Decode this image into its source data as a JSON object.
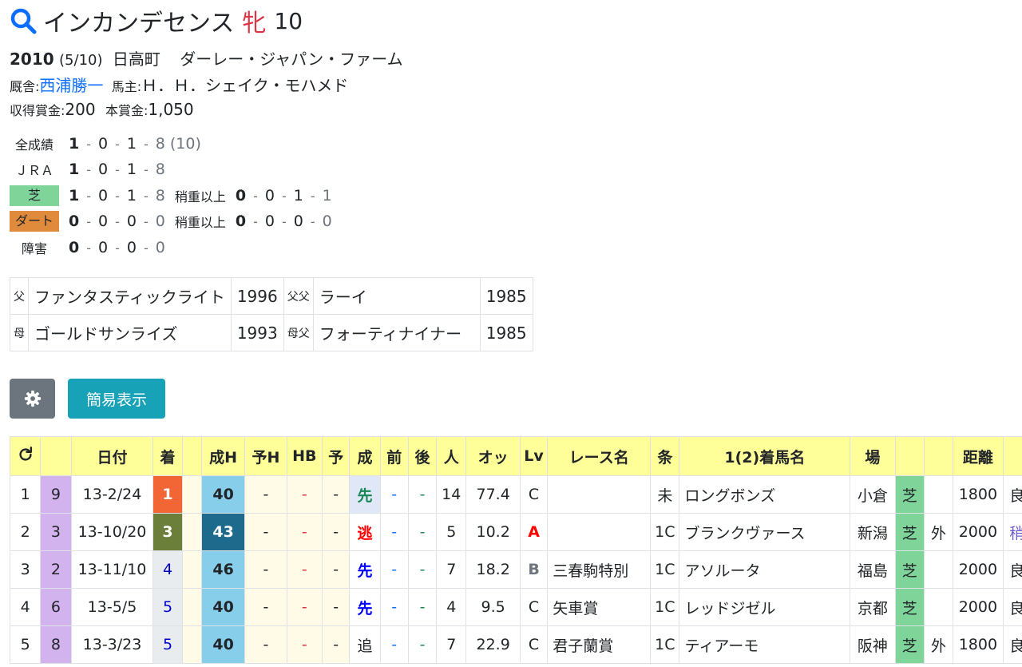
{
  "horse": {
    "name": "インカンデセンス",
    "sex": "牝",
    "age": "10"
  },
  "birth": {
    "year": "2010",
    "date": "(5/10)",
    "place": "日高町",
    "breeder": "ダーレー・ジャパン・ファーム"
  },
  "stable": {
    "label": "厩舎:",
    "trainer": "西浦勝一",
    "owner_label": "馬主:",
    "owner": "Ｈ．Ｈ．シェイク・モハメド"
  },
  "prize": {
    "earned_label": "収得賞金:",
    "earned": "200",
    "main_label": "本賞金:",
    "main": "1,050"
  },
  "records": {
    "all": {
      "label": "全成績",
      "v": [
        "1",
        "0",
        "1",
        "8"
      ],
      "extra": "(10)"
    },
    "jra": {
      "label": "ＪＲＡ",
      "v": [
        "1",
        "0",
        "1",
        "8"
      ]
    },
    "turf": {
      "label": "芝",
      "v": [
        "1",
        "0",
        "1",
        "8"
      ],
      "sub_label": "稍重以上",
      "sub": [
        "0",
        "0",
        "1",
        "1"
      ]
    },
    "dirt": {
      "label": "ダート",
      "v": [
        "0",
        "0",
        "0",
        "0"
      ],
      "sub_label": "稍重以上",
      "sub": [
        "0",
        "0",
        "0",
        "0"
      ]
    },
    "obstacle": {
      "label": "障害",
      "v": [
        "0",
        "0",
        "0",
        "0"
      ]
    }
  },
  "pedigree": {
    "sire_label": "父",
    "sire": "ファンタスティックライト",
    "sire_year": "1996",
    "sire_sire_label": "父父",
    "sire_sire": "ラーイ",
    "sire_sire_year": "1985",
    "dam_label": "母",
    "dam": "ゴールドサンライズ",
    "dam_year": "1993",
    "dam_sire_label": "母父",
    "dam_sire": "フォーティナイナー",
    "dam_sire_year": "1985"
  },
  "buttons": {
    "gear_icon": "gear-icon",
    "simple": "簡易表示"
  },
  "results": {
    "headers": [
      "",
      "",
      "日付",
      "着",
      "",
      "成H",
      "予H",
      "HB",
      "予",
      "成",
      "前",
      "後",
      "人",
      "オッ",
      "Lv",
      "レース名",
      "条",
      "1(2)着馬名",
      "場",
      "",
      "",
      "距離",
      ""
    ],
    "rows": [
      {
        "no": "1",
        "waku": "9",
        "date": "13-2/24",
        "rank": "1",
        "seih": "40",
        "yoh": "-",
        "hb": "-",
        "yo": "-",
        "sei": "先",
        "mae": "-",
        "ato": "-",
        "ninki": "14",
        "odds": "77.4",
        "lv": "C",
        "race": "",
        "cond": "未",
        "winner": "ロングボンズ",
        "place": "小倉",
        "surf": "芝",
        "course": "",
        "dist": "1800",
        "going": "良"
      },
      {
        "no": "2",
        "waku": "3",
        "date": "13-10/20",
        "rank": "3",
        "seih": "43",
        "yoh": "-",
        "hb": "-",
        "yo": "-",
        "sei": "逃",
        "mae": "-",
        "ato": "-",
        "ninki": "5",
        "odds": "10.2",
        "lv": "A",
        "race": "",
        "cond": "1C",
        "winner": "ブランクヴァース",
        "place": "新潟",
        "surf": "芝",
        "course": "外",
        "dist": "2000",
        "going": "稍"
      },
      {
        "no": "3",
        "waku": "2",
        "date": "13-11/10",
        "rank": "4",
        "seih": "46",
        "yoh": "-",
        "hb": "-",
        "yo": "-",
        "sei": "先",
        "mae": "-",
        "ato": "-",
        "ninki": "7",
        "odds": "18.2",
        "lv": "B",
        "race": "三春駒特別",
        "cond": "1C",
        "winner": "アソルータ",
        "place": "福島",
        "surf": "芝",
        "course": "",
        "dist": "2000",
        "going": "良"
      },
      {
        "no": "4",
        "waku": "6",
        "date": "13-5/5",
        "rank": "5",
        "seih": "40",
        "yoh": "-",
        "hb": "-",
        "yo": "-",
        "sei": "先",
        "mae": "-",
        "ato": "-",
        "ninki": "4",
        "odds": "9.5",
        "lv": "C",
        "race": "矢車賞",
        "cond": "1C",
        "winner": "レッドジゼル",
        "place": "京都",
        "surf": "芝",
        "course": "",
        "dist": "2000",
        "going": "良"
      },
      {
        "no": "5",
        "waku": "8",
        "date": "13-3/23",
        "rank": "5",
        "seih": "40",
        "yoh": "-",
        "hb": "-",
        "yo": "-",
        "sei": "追",
        "mae": "-",
        "ato": "-",
        "ninki": "7",
        "odds": "22.9",
        "lv": "C",
        "race": "君子蘭賞",
        "cond": "1C",
        "winner": "ティアーモ",
        "place": "阪神",
        "surf": "芝",
        "course": "外",
        "dist": "1800",
        "going": "良"
      }
    ]
  },
  "colors": {
    "turf": "#7fd49a",
    "dirt": "#e08a3c",
    "header": "#ffff99",
    "seih": "#87ceeb",
    "waku": "#d3b3ee"
  }
}
